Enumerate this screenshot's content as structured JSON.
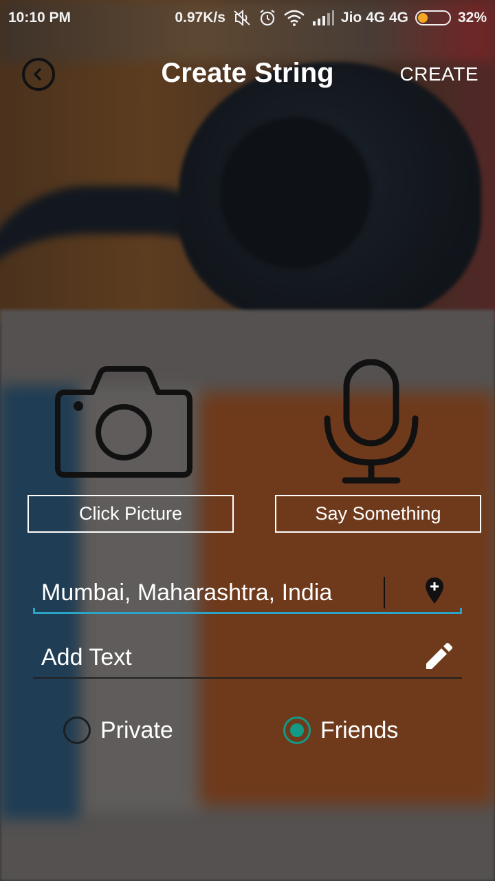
{
  "status_bar": {
    "time": "10:10 PM",
    "net_speed": "0.97K/s",
    "carrier": "Jio 4G 4G",
    "battery_percent": "32%",
    "battery_level": 0.32,
    "icons": [
      "mute-icon",
      "alarm-icon",
      "wifi-icon",
      "signal-icon",
      "battery-icon"
    ]
  },
  "app_bar": {
    "title": "Create String",
    "create_label": "CREATE",
    "back_icon": "back-arrow-icon"
  },
  "media": {
    "picture_label": "Click Picture",
    "voice_label": "Say Something",
    "picture_icon": "camera-icon",
    "voice_icon": "microphone-icon"
  },
  "location_field": {
    "value": "Mumbai, Maharashtra, India",
    "icon": "location-pin-add-icon"
  },
  "text_field": {
    "placeholder": "Add Text",
    "icon": "pencil-icon"
  },
  "visibility": {
    "options": [
      {
        "label": "Private",
        "selected": false
      },
      {
        "label": "Friends",
        "selected": true
      }
    ]
  },
  "colors": {
    "accent": "#2aa5c8",
    "radio_selected": "#139a86",
    "battery_fill": "#f5a623"
  }
}
